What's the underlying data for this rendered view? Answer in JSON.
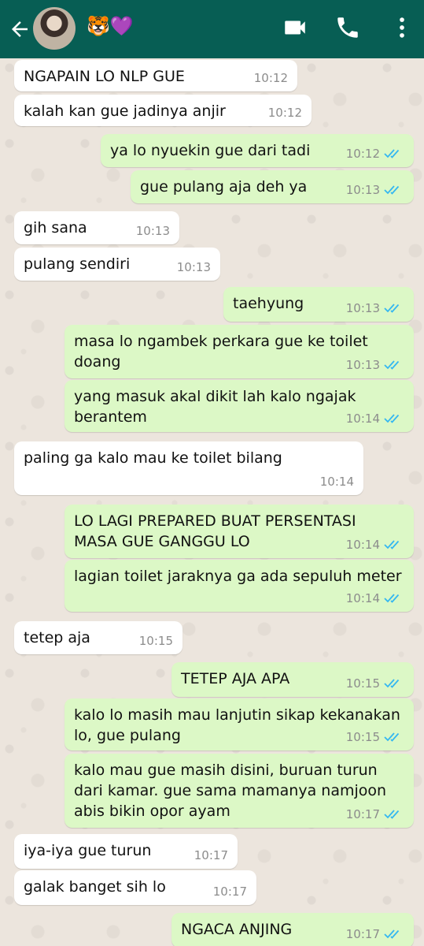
{
  "header": {
    "contact_name": "🐯💜",
    "back_icon": "arrow-left-icon",
    "video_icon": "video-call-icon",
    "call_icon": "phone-icon",
    "menu_icon": "more-vert-icon"
  },
  "colors": {
    "header": "#075e54",
    "incoming": "#ffffff",
    "outgoing": "#dcf8c6",
    "read_ticks": "#34b7f1"
  },
  "messages": [
    {
      "dir": "in",
      "text": "NGAPAIN LO NLP GUE",
      "time": "10:12"
    },
    {
      "dir": "in",
      "text": "kalah kan gue jadinya anjir",
      "time": "10:12"
    },
    {
      "dir": "out",
      "text": "ya lo nyuekin gue dari tadi",
      "time": "10:12"
    },
    {
      "dir": "out",
      "text": "gue pulang aja deh ya",
      "time": "10:13"
    },
    {
      "dir": "in",
      "text": "gih sana",
      "time": "10:13"
    },
    {
      "dir": "in",
      "text": "pulang sendiri",
      "time": "10:13"
    },
    {
      "dir": "out",
      "text": "taehyung",
      "time": "10:13"
    },
    {
      "dir": "out",
      "text": "masa lo ngambek perkara gue ke toilet\ndoang",
      "time": "10:13"
    },
    {
      "dir": "out",
      "text": "yang masuk akal dikit lah kalo ngajak\nberantem",
      "time": "10:14"
    },
    {
      "dir": "in",
      "text": "paling ga kalo mau ke toilet bilang",
      "time": "10:14"
    },
    {
      "dir": "out",
      "text": "LO LAGI PREPARED BUAT PERSENTASI\nMASA GUE GANGGU LO",
      "time": "10:14"
    },
    {
      "dir": "out",
      "text": "lagian toilet jaraknya ga ada sepuluh meter",
      "time": "10:14"
    },
    {
      "dir": "in",
      "text": "tetep aja",
      "time": "10:15"
    },
    {
      "dir": "out",
      "text": "TETEP AJA APA",
      "time": "10:15"
    },
    {
      "dir": "out",
      "text": "kalo lo masih mau lanjutin sikap kekanakan\nlo,  gue pulang",
      "time": "10:15"
    },
    {
      "dir": "out",
      "text": "kalo mau gue masih disini,  buruan turun\ndari kamar. gue sama mamanya namjoon\nabis bikin opor ayam",
      "time": "10:17"
    },
    {
      "dir": "in",
      "text": "iya-iya gue turun",
      "time": "10:17"
    },
    {
      "dir": "in",
      "text": "galak banget sih lo",
      "time": "10:17"
    },
    {
      "dir": "out",
      "text": "NGACA ANJING",
      "time": "10:17"
    }
  ]
}
